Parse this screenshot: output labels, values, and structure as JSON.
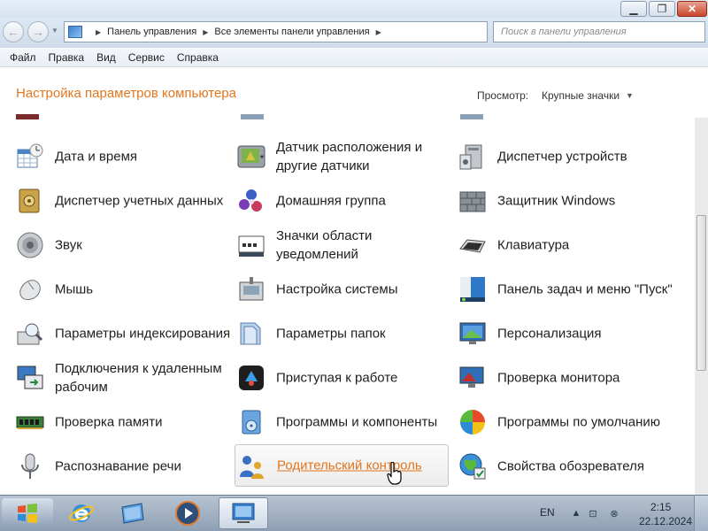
{
  "window": {
    "minimize_icon": "minimize-icon",
    "maximize_icon": "restore-icon",
    "close_icon": "close-icon"
  },
  "address": {
    "crumbs": [
      "Панель управления",
      "Все элементы панели управления"
    ],
    "search_placeholder": "Поиск в панели управления"
  },
  "menu": [
    "Файл",
    "Правка",
    "Вид",
    "Сервис",
    "Справка"
  ],
  "header": {
    "title": "Настройка параметров компьютера",
    "view_label": "Просмотр:",
    "view_value": "Крупные значки"
  },
  "items": [
    {
      "label": "Дата и время",
      "icon": "calendar-clock-icon"
    },
    {
      "label": "Датчик расположения и другие датчики",
      "icon": "location-sensor-icon"
    },
    {
      "label": "Диспетчер устройств",
      "icon": "device-manager-icon"
    },
    {
      "label": "Диспетчер учетных данных",
      "icon": "credential-vault-icon"
    },
    {
      "label": "Домашняя группа",
      "icon": "homegroup-icon"
    },
    {
      "label": "Защитник Windows",
      "icon": "defender-wall-icon"
    },
    {
      "label": "Звук",
      "icon": "speaker-icon"
    },
    {
      "label": "Значки области уведомлений",
      "icon": "tray-icons-icon"
    },
    {
      "label": "Клавиатура",
      "icon": "keyboard-icon"
    },
    {
      "label": "Мышь",
      "icon": "mouse-icon"
    },
    {
      "label": "Настройка системы",
      "icon": "system-config-icon"
    },
    {
      "label": "Панель задач и меню \"Пуск\"",
      "icon": "taskbar-start-icon"
    },
    {
      "label": "Параметры индексирования",
      "icon": "indexing-icon"
    },
    {
      "label": "Параметры папок",
      "icon": "folder-options-icon"
    },
    {
      "label": "Персонализация",
      "icon": "personalization-icon"
    },
    {
      "label": "Подключения к удаленным рабочим",
      "icon": "remote-desktop-icon"
    },
    {
      "label": "Приступая к работе",
      "icon": "getting-started-icon"
    },
    {
      "label": "Проверка монитора",
      "icon": "monitor-check-icon"
    },
    {
      "label": "Проверка памяти",
      "icon": "memory-icon"
    },
    {
      "label": "Программы и компоненты",
      "icon": "programs-icon"
    },
    {
      "label": "Программы по умолчанию",
      "icon": "default-programs-icon"
    },
    {
      "label": "Распознавание речи",
      "icon": "microphone-icon"
    },
    {
      "label": "Родительский контроль",
      "icon": "parental-control-icon"
    },
    {
      "label": "Свойства обозревателя",
      "icon": "internet-options-icon"
    }
  ],
  "taskbar": {
    "apps": [
      "internet-explorer-icon",
      "windows-explorer-icon",
      "media-player-icon",
      "control-panel-icon"
    ],
    "lang": "EN",
    "time": "2:15",
    "date": "22.12.2024"
  }
}
